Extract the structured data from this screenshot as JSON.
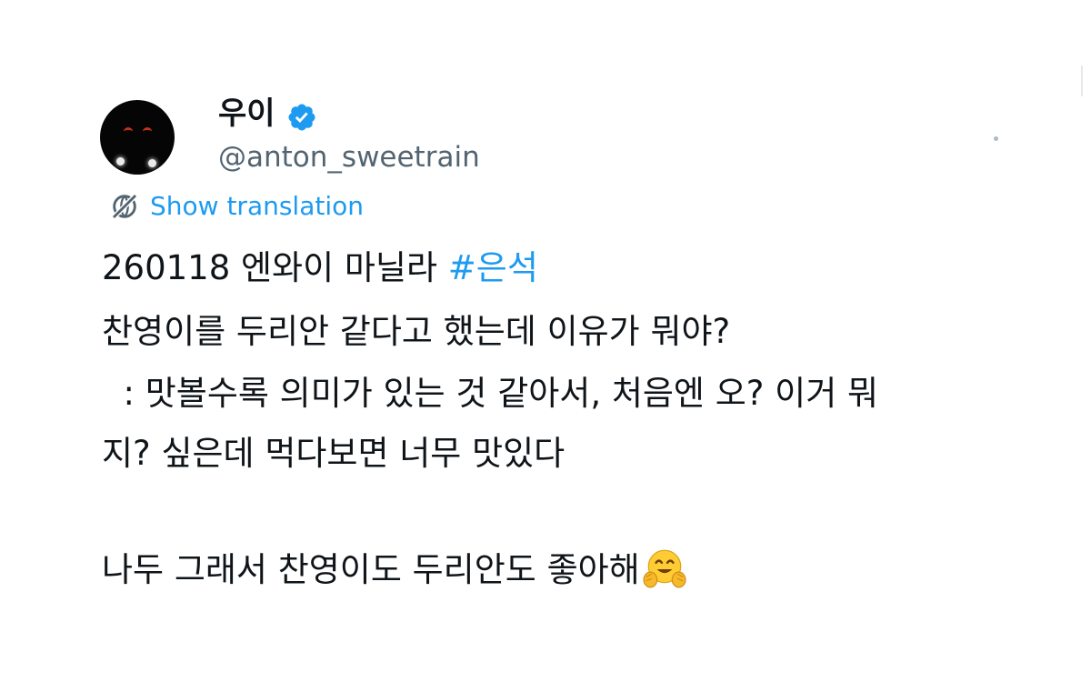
{
  "user": {
    "display_name": "우이",
    "handle": "@anton_sweetrain",
    "verified": true
  },
  "translation": {
    "label": "Show translation",
    "icon": "globe-slash-icon"
  },
  "tweet": {
    "line1_text": "260118 엔와이 마닐라 ",
    "hashtag": "#은석",
    "line2": "찬영이를 두리안 같다고 했는데 이유가 뭐야?",
    "line3": "  : 맛볼수록 의미가 있는 것 같아서, 처음엔 오? 이거 뭐",
    "line4": "지? 싶은데 먹다보면 너무 맛있다",
    "line5": "나두 그래서 찬영이도 두리안도 좋아해",
    "emoji": "hugging-face-emoji"
  },
  "colors": {
    "accent": "#1d9bf0",
    "text": "#0f1419",
    "secondary": "#536471",
    "background": "#ffffff"
  }
}
